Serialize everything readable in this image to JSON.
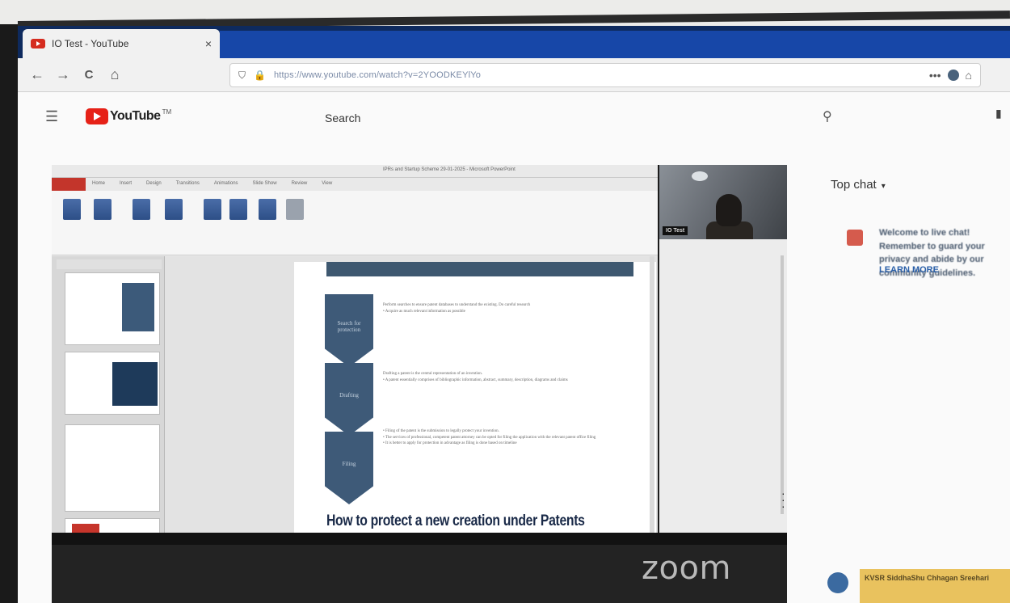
{
  "browser": {
    "tab_title": "IO Test - YouTube",
    "tab_close": "×",
    "url": "https://www.youtube.com/watch?v=2YOODKEYlYo",
    "nav": {
      "back": "←",
      "forward": "→",
      "reload": "C",
      "home": "⌂"
    },
    "url_menu": "•••"
  },
  "youtube": {
    "logo_text": "YouTube",
    "logo_tm": "TM",
    "search_placeholder": "Search"
  },
  "video": {
    "ppt_window_title": "IPRs and Startup Scheme 29-01-2025 - Microsoft PowerPoint",
    "ribbon_tabs": [
      "Home",
      "Insert",
      "Design",
      "Transitions",
      "Animations",
      "Slide Show",
      "Review",
      "View"
    ],
    "cam_name": "IO Test",
    "slide": {
      "steps": [
        {
          "label": "Search for\nprotection",
          "bullets": [
            "Perform searches to ensure patent databases to understand the existing. Do careful research",
            "• Acquire as much relevant information as possible"
          ]
        },
        {
          "label": "Drafting",
          "bullets": [
            "Drafting a patent is the central representation of an invention.",
            "• A patent essentially comprises of bibliographic information, abstract, summary, description, diagrams and claims"
          ]
        },
        {
          "label": "Filing",
          "bullets": [
            "• Filing of the patent is the submission to legally protect your invention.",
            "• The services of professional, competent patent attorney can be opted for filing the application with the relevant patent office filing",
            "• It is better to apply for protection in advantage as filing is done based on timeline"
          ]
        }
      ],
      "headline": "How to protect a new creation under Patents"
    },
    "zoom_label": "zoom"
  },
  "chat": {
    "header": "Top chat",
    "caret": "▾",
    "welcome": "Welcome to live chat! Remember to guard your privacy and abide by our community guidelines.",
    "learn_more": "LEARN MORE",
    "bottom_message": "KVSR SiddhaShu Chhagan Sreehari"
  }
}
